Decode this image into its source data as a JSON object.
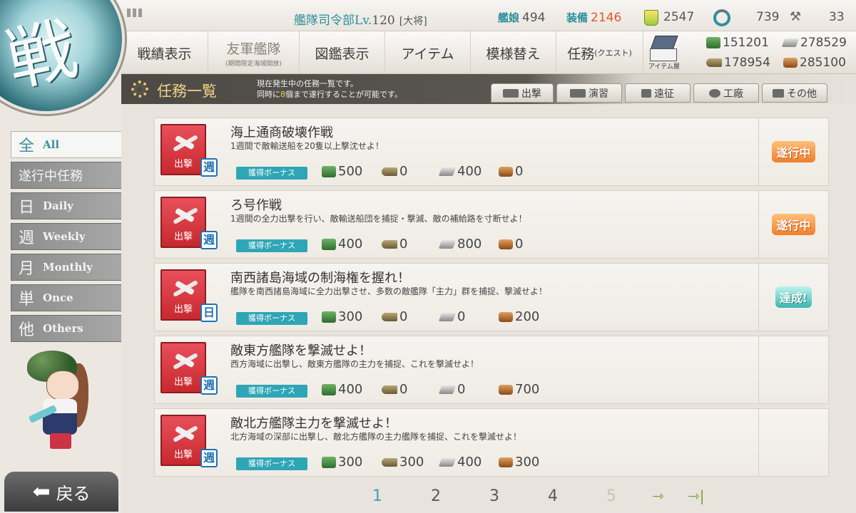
{
  "status": {
    "hq_label": "艦隊司令部",
    "lv_label": "Lv.",
    "level": "120",
    "rank": "[大将]",
    "ship_label": "艦娘",
    "ship_count": "494",
    "equip_label": "装備",
    "equip_count": "2146",
    "bucket": "2547",
    "dev_material": "739",
    "screws": "33"
  },
  "nav": {
    "record": "戦績表示",
    "friend_fleet": "友軍艦隊",
    "friend_fleet_sub": "(期間限定海域開放)",
    "album": "図鑑表示",
    "item": "アイテム",
    "furniture": "模様替え",
    "quest": "任務",
    "quest_sub": "(クエスト)",
    "shop": "アイテム屋"
  },
  "resources": {
    "fuel": "151201",
    "steel": "278529",
    "ammo": "178954",
    "bauxite": "285100"
  },
  "header": {
    "title": "任務一覧",
    "desc_line1": "現在発生中の任務一覧です。",
    "desc_line2_a": "同時に",
    "desc_line2_num": "8",
    "desc_line2_b": "個まで遂行することが可能です。"
  },
  "category_tabs": [
    "出撃",
    "演習",
    "遠征",
    "工廠",
    "その他"
  ],
  "filters": [
    {
      "char": "全",
      "en": "All"
    },
    {
      "label": "遂行中任務"
    },
    {
      "char": "日",
      "en": "Daily"
    },
    {
      "char": "週",
      "en": "Weekly"
    },
    {
      "char": "月",
      "en": "Monthly"
    },
    {
      "char": "単",
      "en": "Once"
    },
    {
      "char": "他",
      "en": "Others"
    }
  ],
  "quests": [
    {
      "title": "海上通商破壊作戦",
      "desc": "1週間で敵輸送船を20隻以上撃沈せよ！",
      "category": "出撃",
      "freq": "週",
      "bonus": "獲得ボーナス",
      "fuel": "500",
      "ammo": "0",
      "steel": "400",
      "bauxite": "0",
      "status": "遂行中"
    },
    {
      "title": "ろ号作戦",
      "desc": "1週間の全力出撃を行い、敵輸送船団を捕捉・撃滅、敵の補給路を寸断せよ！",
      "category": "出撃",
      "freq": "週",
      "bonus": "獲得ボーナス",
      "fuel": "400",
      "ammo": "0",
      "steel": "800",
      "bauxite": "0",
      "status": "遂行中"
    },
    {
      "title": "南西諸島海域の制海権を握れ！",
      "desc": "艦隊を南西諸島海域に全力出撃させ、多数の敵艦隊「主力」群を捕捉、撃滅せよ！",
      "category": "出撃",
      "freq": "日",
      "bonus": "獲得ボーナス",
      "fuel": "300",
      "ammo": "0",
      "steel": "0",
      "bauxite": "200",
      "status": "達成!"
    },
    {
      "title": "敵東方艦隊を撃滅せよ！",
      "desc": "西方海域に出撃し、敵東方艦隊の主力を捕捉、これを撃滅せよ！",
      "category": "出撃",
      "freq": "週",
      "bonus": "獲得ボーナス",
      "fuel": "400",
      "ammo": "0",
      "steel": "0",
      "bauxite": "700",
      "status": ""
    },
    {
      "title": "敵北方艦隊主力を撃滅せよ！",
      "desc": "北方海域の深部に出撃し、敵北方艦隊の主力艦隊を捕捉、これを撃滅せよ！",
      "category": "出撃",
      "freq": "週",
      "bonus": "獲得ボーナス",
      "fuel": "300",
      "ammo": "300",
      "steel": "400",
      "bauxite": "300",
      "status": ""
    }
  ],
  "pagination": {
    "pages": [
      "1",
      "2",
      "3",
      "4",
      "5"
    ],
    "current": "1"
  },
  "back_label": "戻る",
  "colors": {
    "accent": "#2fa6b6",
    "badge_red": "#c8282e",
    "ongoing": "#f07e2b",
    "done": "#3bb6b0"
  }
}
